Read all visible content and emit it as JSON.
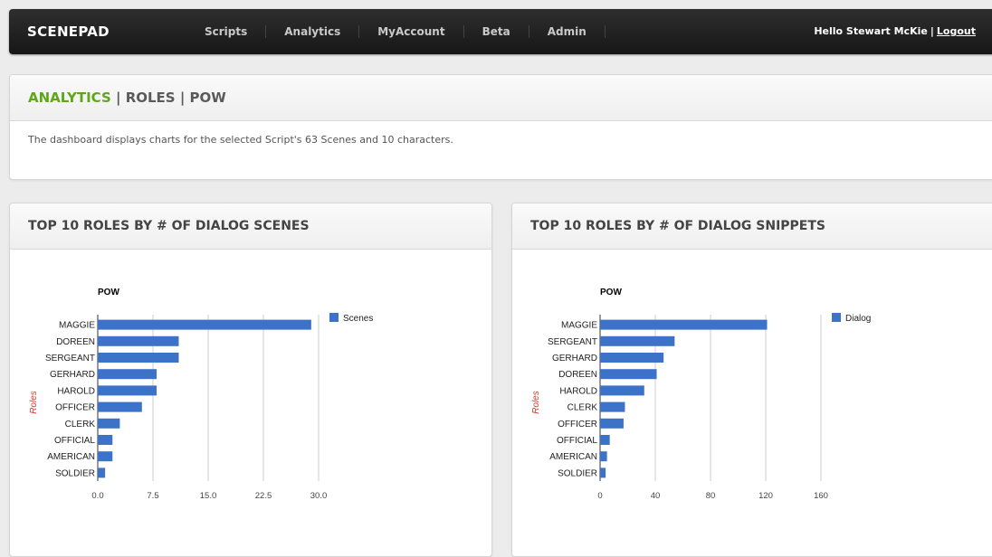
{
  "nav": {
    "brand": "SCENEPAD",
    "items": [
      "Scripts",
      "Analytics",
      "MyAccount",
      "Beta",
      "Admin"
    ],
    "greeting": "Hello Stewart McKie",
    "separator": "|",
    "logout": "Logout"
  },
  "intro": {
    "title_accent": "ANALYTICS",
    "title_rest": "| ROLES | POW",
    "description": "The dashboard displays charts for the selected Script's 63 Scenes and 10 characters."
  },
  "colors": {
    "accent": "#5ea71a",
    "bar": "#3d72c9",
    "axis_title": "#e0312b"
  },
  "chart_data": [
    {
      "type": "bar",
      "orientation": "horizontal",
      "panel_title": "TOP 10 ROLES BY # OF DIALOG SCENES",
      "title": "POW",
      "ylabel": "Roles",
      "xlabel": "",
      "categories": [
        "MAGGIE",
        "DOREEN",
        "SERGEANT",
        "GERHARD",
        "HAROLD",
        "OFFICER",
        "CLERK",
        "OFFICIAL",
        "AMERICAN",
        "SOLDIER"
      ],
      "series": [
        {
          "name": "Scenes",
          "values": [
            29,
            11,
            11,
            8,
            8,
            6,
            3,
            2,
            2,
            1
          ]
        }
      ],
      "xlim": [
        0,
        30
      ],
      "ticks": [
        "0.0",
        "7.5",
        "15.0",
        "22.5",
        "30.0"
      ],
      "tick_values": [
        0,
        7.5,
        15,
        22.5,
        30
      ],
      "legend": "right",
      "grid": true
    },
    {
      "type": "bar",
      "orientation": "horizontal",
      "panel_title": "TOP 10 ROLES BY # OF DIALOG SNIPPETS",
      "title": "POW",
      "ylabel": "Roles",
      "xlabel": "",
      "categories": [
        "MAGGIE",
        "SERGEANT",
        "GERHARD",
        "DOREEN",
        "HAROLD",
        "CLERK",
        "OFFICER",
        "OFFICIAL",
        "AMERICAN",
        "SOLDIER"
      ],
      "series": [
        {
          "name": "Dialog",
          "values": [
            121,
            54,
            46,
            41,
            32,
            18,
            17,
            7,
            5,
            4
          ]
        }
      ],
      "xlim": [
        0,
        160
      ],
      "ticks": [
        "0",
        "40",
        "80",
        "120",
        "160"
      ],
      "tick_values": [
        0,
        40,
        80,
        120,
        160
      ],
      "legend": "right",
      "grid": true
    }
  ]
}
